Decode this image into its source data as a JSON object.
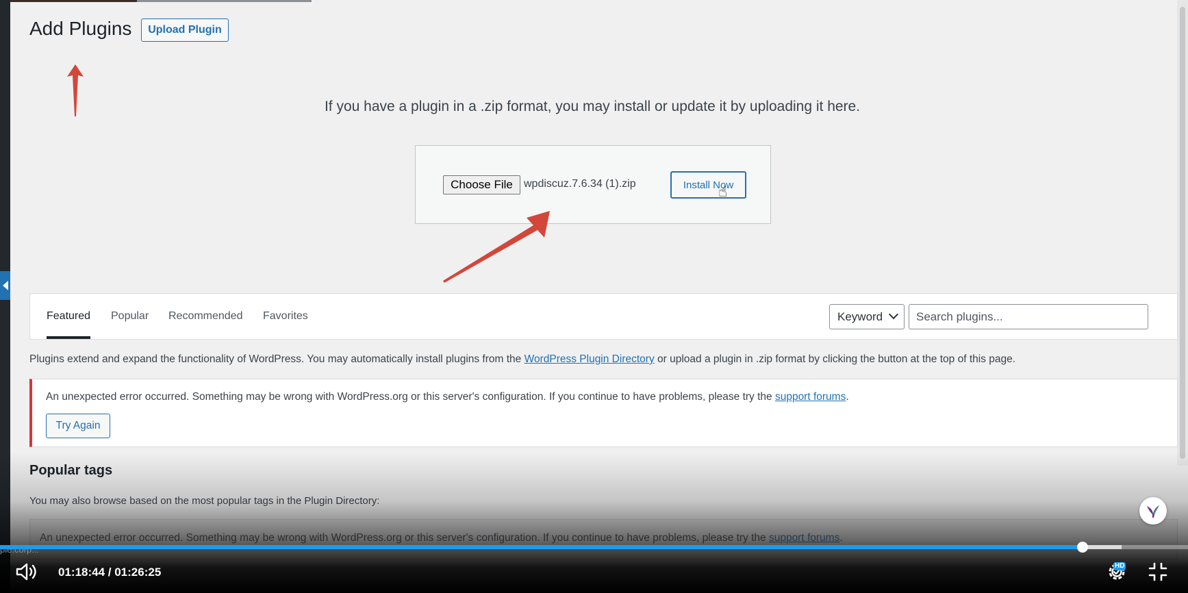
{
  "page": {
    "title": "Add Plugins",
    "upload_button": "Upload Plugin",
    "intro": "If you have a plugin in a .zip format, you may install or update it by uploading it here."
  },
  "upload_form": {
    "choose_file_label": "Choose File",
    "file_name": "wpdiscuz.7.6.34 (1).zip",
    "install_button": "Install Now"
  },
  "filter": {
    "tabs": [
      {
        "label": "Featured",
        "active": true
      },
      {
        "label": "Popular",
        "active": false
      },
      {
        "label": "Recommended",
        "active": false
      },
      {
        "label": "Favorites",
        "active": false
      }
    ],
    "search_type": "Keyword",
    "search_placeholder": "Search plugins..."
  },
  "description": {
    "text_before": "Plugins extend and expand the functionality of WordPress. You may automatically install plugins from the ",
    "link": "WordPress Plugin Directory",
    "text_after": " or upload a plugin in .zip format by clicking the button at the top of this page."
  },
  "error_notice": {
    "text_before": "An unexpected error occurred. Something may be wrong with WordPress.org or this server's configuration. If you continue to have problems, please try the ",
    "link": "support forums",
    "text_after": ".",
    "button": "Try Again"
  },
  "popular_tags": {
    "title": "Popular tags",
    "description": "You may also browse based on the most popular tags in the Plugin Directory:",
    "error_text_before": "An unexpected error occurred. Something may be wrong with WordPress.org or this server's configuration. If you continue to have problems, please try the ",
    "error_link": "support forums",
    "error_text_after": "."
  },
  "status_url": "ple.corp...",
  "player": {
    "current_time": "01:18:44",
    "total_time": "01:26:25",
    "time_display": "01:18:44 / 01:26:25",
    "progress_played": 0.911,
    "progress_buffered": 0.944,
    "quality_badge": "HD"
  },
  "colors": {
    "wp_blue": "#2271b1",
    "error_red": "#d63638",
    "annotation_red": "#d2473a",
    "player_blue": "#1a9bf0"
  },
  "icons": [
    "volume-icon",
    "settings-icon",
    "fullscreen-icon",
    "bird-icon",
    "hand-cursor-icon",
    "chevron-down-icon",
    "sidebar-collapse-icon"
  ]
}
